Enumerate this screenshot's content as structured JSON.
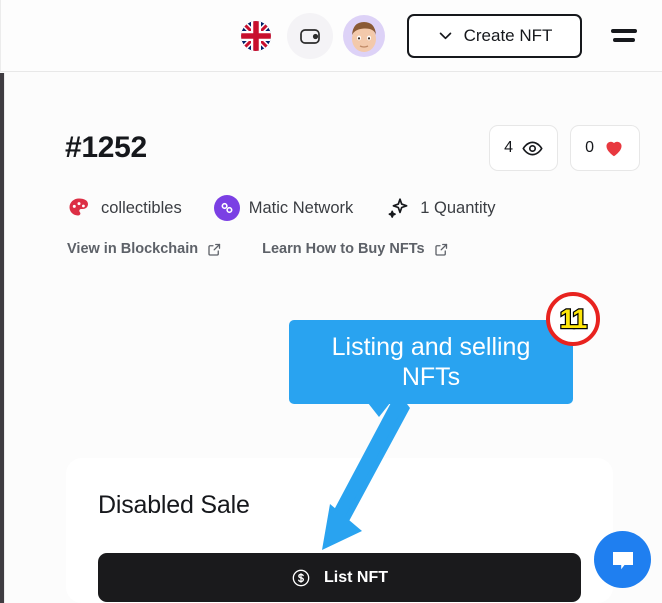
{
  "header": {
    "language_icon": "uk-flag-icon",
    "wallet_icon": "wallet-icon",
    "avatar_icon": "user-avatar",
    "create_nft_label": "Create NFT",
    "chevron_icon": "chevron-down-icon",
    "menu_icon": "hamburger-menu-icon"
  },
  "main": {
    "title": "#1252",
    "stats": [
      {
        "value": "4",
        "icon": "eye-icon"
      },
      {
        "value": "0",
        "icon": "heart-icon"
      }
    ],
    "meta": [
      {
        "label": "collectibles",
        "icon": "palette-icon"
      },
      {
        "label": "Matic Network",
        "icon": "polygon-icon"
      },
      {
        "label": "1 Quantity",
        "icon": "sparkle-icon"
      }
    ],
    "links": [
      {
        "label": "View in Blockchain",
        "icon": "external-link-icon"
      },
      {
        "label": "Learn How to Buy NFTs",
        "icon": "external-link-icon"
      }
    ]
  },
  "sale_card": {
    "title": "Disabled Sale",
    "list_button_label": "List NFT",
    "list_button_icon": "dollar-circle-icon"
  },
  "annotation": {
    "callout_text": "Listing and selling NFTs",
    "step_number": "11",
    "arrow_icon": "down-left-arrow-icon"
  },
  "chat": {
    "icon": "chat-bubble-icon"
  },
  "colors": {
    "accent_blue": "#29a3f0",
    "badge_red": "#e8231f",
    "badge_yellow": "#ffe60a",
    "polygon_purple": "#7b3fe4",
    "heart_red": "#e8383f",
    "button_black": "#1a1a1c",
    "chat_blue": "#1f7ff0"
  }
}
